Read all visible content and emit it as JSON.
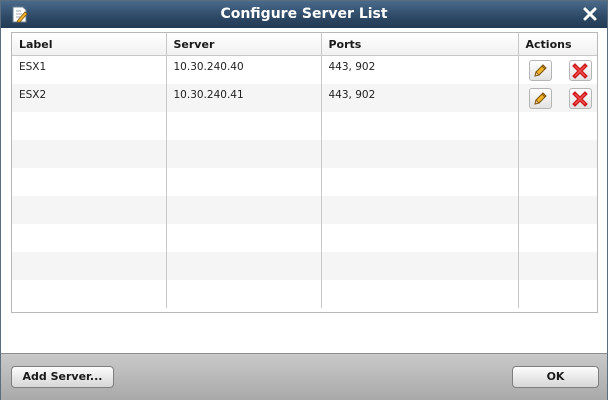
{
  "dialog": {
    "title": "Configure Server List"
  },
  "table": {
    "columns": [
      "Label",
      "Server",
      "Ports",
      "Actions"
    ],
    "rows": [
      {
        "label": "ESX1",
        "server": "10.30.240.40",
        "ports": "443, 902"
      },
      {
        "label": "ESX2",
        "server": "10.30.240.41",
        "ports": "443, 902"
      }
    ],
    "empty_row_count": 7
  },
  "footer": {
    "add_label": "Add Server...",
    "ok_label": "OK"
  },
  "icons": {
    "title": "edit-document-icon",
    "close": "close-icon",
    "edit": "pencil-icon",
    "delete": "red-x-icon"
  },
  "colors": {
    "titlebar": "#2f4b68",
    "delete_red": "#cc1a1a",
    "pencil_yellow": "#f0b429"
  }
}
